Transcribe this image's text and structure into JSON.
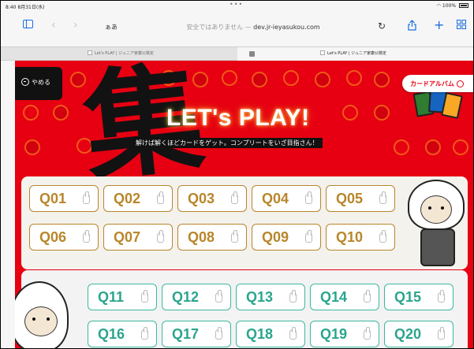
{
  "status_bar": {
    "time": "8:40  8月31日(水)",
    "battery": "100%"
  },
  "nav_bar": {
    "text_size_label": "ぁあ",
    "url_prefix": "安全ではありません — ",
    "url_domain": "dev.jr-ieyasukou.com"
  },
  "tabs": [
    {
      "title": "Let's PLAY | ジュニア家康公検定"
    },
    {
      "title": "Let's PLAY | ジュニア家康公検定"
    }
  ],
  "page": {
    "close_label": "やめる",
    "album_label": "カードアルバム",
    "title": "LET's PLAY!",
    "subtitle": "解けば解くほどカードをゲット。コンプリートをいざ目指さん！",
    "big_glyph": "集"
  },
  "question_rows": [
    {
      "style": "gold",
      "items": [
        "Q01",
        "Q02",
        "Q03",
        "Q04",
        "Q05"
      ]
    },
    {
      "style": "gold",
      "items": [
        "Q06",
        "Q07",
        "Q08",
        "Q09",
        "Q10"
      ]
    },
    {
      "style": "green",
      "items": [
        "Q11",
        "Q12",
        "Q13",
        "Q14",
        "Q15"
      ]
    },
    {
      "style": "green",
      "items": [
        "Q16",
        "Q17",
        "Q18",
        "Q19",
        "Q20"
      ]
    }
  ],
  "colors": {
    "brand_red": "#e60012",
    "gold": "#b8862b",
    "green": "#2aa58d",
    "link_blue": "#1a6fe0"
  },
  "icons": [
    "sidebar-icon",
    "back-icon",
    "forward-icon",
    "reload-icon",
    "share-icon",
    "new-tab-icon",
    "tabs-overview-icon",
    "close-circle-icon",
    "album-circle-icon",
    "tap-hand-icon"
  ]
}
